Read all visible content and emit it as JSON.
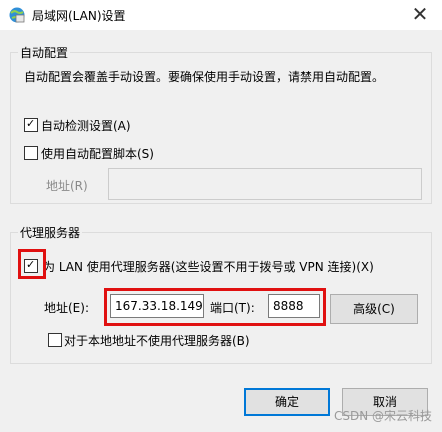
{
  "window": {
    "title": "局域网(LAN)设置",
    "close_glyph": "✕"
  },
  "auto_config": {
    "group_title": "自动配置",
    "description": "自动配置会覆盖手动设置。要确保使用手动设置，请禁用自动配置。",
    "auto_detect": {
      "label": "自动检测设置(A)",
      "checked": true
    },
    "use_script": {
      "label": "使用自动配置脚本(S)",
      "checked": false
    },
    "address_label": "地址(R)",
    "address_value": ""
  },
  "proxy": {
    "group_title": "代理服务器",
    "use_proxy": {
      "label": "为 LAN 使用代理服务器(这些设置不用于拨号或 VPN 连接)(X)",
      "checked": true
    },
    "address_label": "地址(E):",
    "address_value": "167.33.18.149",
    "port_label": "端口(T):",
    "port_value": "8888",
    "advanced_button": "高级(C)",
    "bypass_local": {
      "label": "对于本地地址不使用代理服务器(B)",
      "checked": false
    }
  },
  "buttons": {
    "ok": "确定",
    "cancel": "取消"
  },
  "watermark": "CSDN @宋云科技",
  "check_glyph": "✓",
  "colors": {
    "highlight": "#e01010",
    "focus": "#0078d7"
  }
}
